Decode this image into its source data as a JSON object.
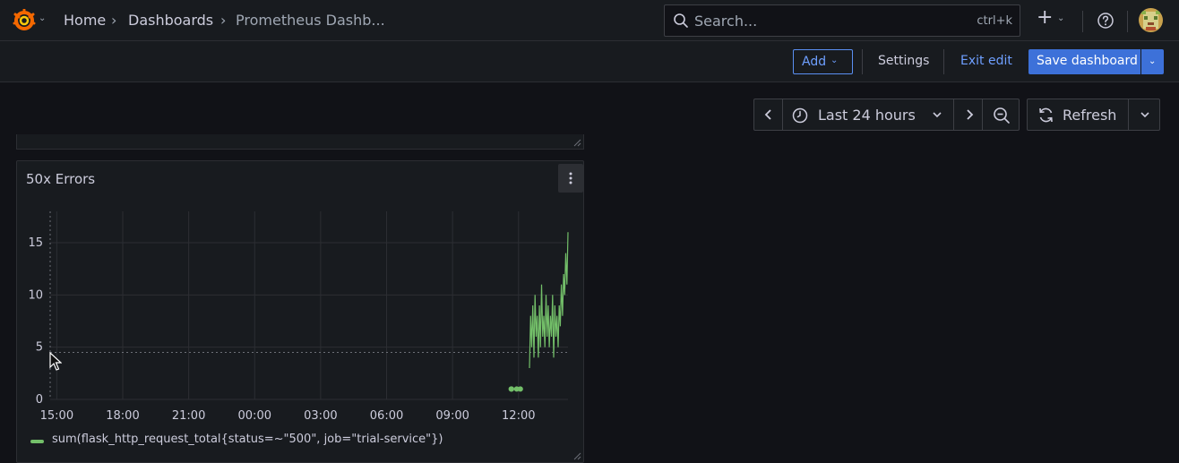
{
  "nav": {
    "breadcrumbs": [
      "Home",
      "Dashboards",
      "Prometheus Dashb..."
    ],
    "separator": "›",
    "search_placeholder": "Search...",
    "search_shortcut": "ctrl+k",
    "plus_glyph": "+"
  },
  "toolbar": {
    "add_label": "Add",
    "settings_label": "Settings",
    "exit_label": "Exit edit",
    "save_label": "Save dashboard"
  },
  "time": {
    "range_label": "Last 24 hours",
    "refresh_label": "Refresh"
  },
  "panel": {
    "title": "50x Errors",
    "legend": "sum(flask_http_request_total{status=~\"500\", job=\"trial-service\"})"
  },
  "colors": {
    "series": "#73bf69",
    "accent": "#3d71d9",
    "link": "#6e9fff"
  },
  "chart_data": {
    "type": "line",
    "title": "50x Errors",
    "x_ticks": [
      "15:00",
      "18:00",
      "21:00",
      "00:00",
      "03:00",
      "06:00",
      "09:00",
      "12:00"
    ],
    "y_ticks": [
      0,
      5,
      10,
      15
    ],
    "ylim": [
      0,
      18
    ],
    "grid": true,
    "legend_placement": "bottom-left",
    "series": [
      {
        "name": "sum(flask_http_request_total{status=~\"500\", job=\"trial-service\"})",
        "segments": [
          [
            [
              "11:40",
              1
            ],
            [
              "11:41",
              1
            ]
          ],
          [
            [
              "11:55",
              1
            ],
            [
              "12:05",
              1
            ]
          ],
          [
            [
              "12:30",
              3
            ],
            [
              "12:33",
              8
            ],
            [
              "12:36",
              5
            ],
            [
              "12:39",
              9
            ],
            [
              "12:42",
              4
            ],
            [
              "12:45",
              10
            ],
            [
              "12:48",
              6
            ],
            [
              "12:51",
              8
            ],
            [
              "12:54",
              4
            ],
            [
              "12:57",
              9
            ],
            [
              "13:00",
              5
            ],
            [
              "13:03",
              11
            ],
            [
              "13:06",
              6
            ],
            [
              "13:09",
              8
            ],
            [
              "13:12",
              5
            ],
            [
              "13:15",
              10
            ],
            [
              "13:18",
              6
            ],
            [
              "13:21",
              9
            ],
            [
              "13:24",
              5
            ],
            [
              "13:27",
              8
            ],
            [
              "13:30",
              6
            ],
            [
              "13:33",
              10
            ],
            [
              "13:36",
              4
            ],
            [
              "13:39",
              9
            ],
            [
              "13:42",
              6
            ],
            [
              "13:45",
              8
            ],
            [
              "13:48",
              5
            ],
            [
              "13:51",
              9
            ],
            [
              "13:54",
              7
            ],
            [
              "13:57",
              11
            ],
            [
              "14:00",
              8
            ],
            [
              "14:03",
              12
            ],
            [
              "14:06",
              10
            ],
            [
              "14:09",
              14
            ],
            [
              "14:12",
              11
            ],
            [
              "14:15",
              16
            ]
          ]
        ]
      }
    ]
  }
}
